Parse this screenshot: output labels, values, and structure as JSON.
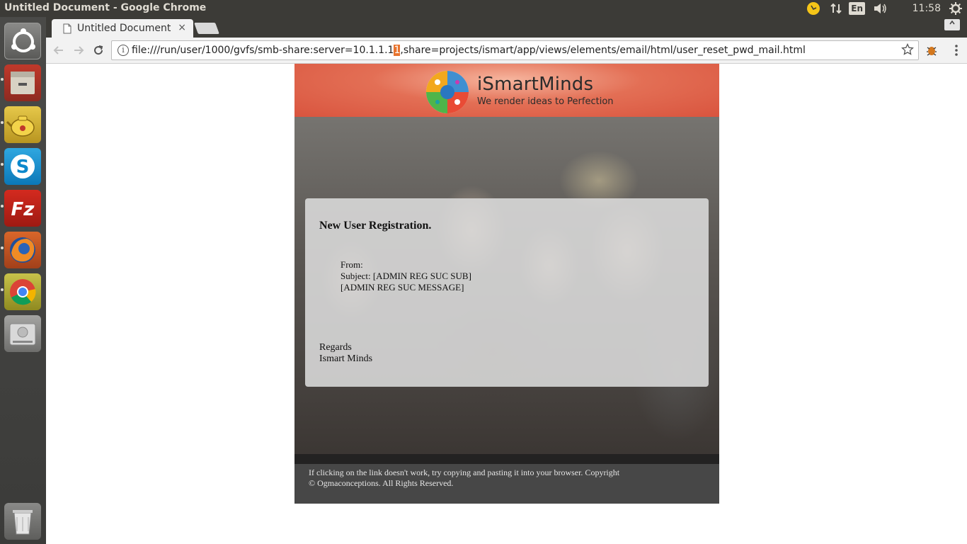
{
  "top_panel": {
    "window_title": "Untitled Document - Google Chrome",
    "keyboard_layout": "En",
    "clock": "11:58 AM",
    "icons": [
      "weather-icon",
      "network-arrows-icon",
      "keyboard-icon",
      "volume-icon",
      "settings-gear-icon"
    ]
  },
  "launcher": {
    "items": [
      "ubuntu-dash-icon",
      "files-icon",
      "teapot-app-icon",
      "skype-icon",
      "filezilla-icon",
      "firefox-icon",
      "chrome-icon",
      "disk-drive-icon",
      "trash-icon"
    ]
  },
  "browser": {
    "tab_title": "Untitled Document",
    "tab_close": "×",
    "url_before": "file:///run/user/1000/gvfs/smb-share:server=10.1.1.1",
    "url_highlight": "1",
    "url_after": ",share=projects/ismart/app/views/elements/email/html/user_reset_pwd_mail.html"
  },
  "email": {
    "brand_name": "iSmartMinds",
    "brand_tagline": "We render ideas to Perfection",
    "heading": "New User Registration.",
    "from_label": "From:",
    "subject_line": "Subject: [ADMIN REG SUC SUB]",
    "message_line": "[ADMIN REG SUC MESSAGE]",
    "regards": "Regards",
    "signature": "Ismart Minds",
    "footer_text": "If clicking on the link doesn't work, try copying and pasting it into your browser. Copyright © Ogmaconceptions. All Rights Reserved."
  },
  "colors": {
    "header_accent": "#d9543e",
    "url_highlight_bg": "#e8742f",
    "panel_bg": "#3c3b37"
  }
}
